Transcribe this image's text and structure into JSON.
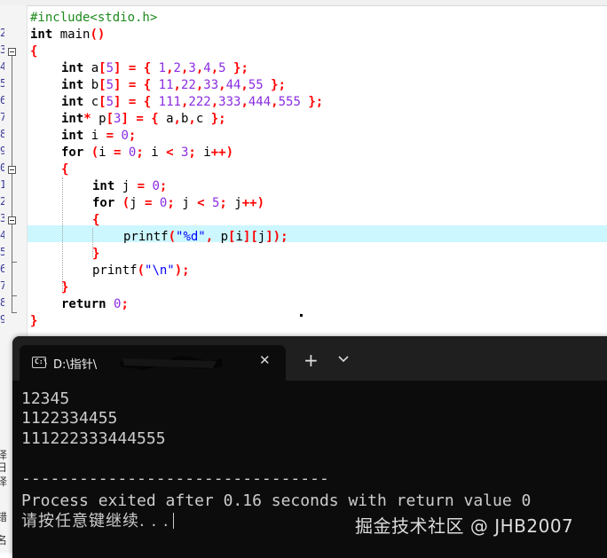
{
  "editor": {
    "line_numbers": [
      "2",
      "3",
      "4",
      "5",
      "6",
      "7",
      "8",
      "9",
      "0",
      "1",
      "2",
      "3",
      "4",
      "5",
      "6",
      "7",
      "8",
      "9",
      "0"
    ],
    "code_lines": [
      "#include<stdio.h>",
      "int main()",
      "{",
      "int a[5] = { 1,2,3,4,5 };",
      "int b[5] = { 11,22,33,44,55 };",
      "int c[5] = { 111,222,333,444,555 };",
      "int* p[3] = { a,b,c };",
      "int i = 0;",
      "for (i = 0; i < 3; i++)",
      "{",
      "int j = 0;",
      "for (j = 0; j < 5; j++)",
      "{",
      "printf(\"%d\", p[i][j]);",
      "}",
      "printf(\"\\n\");",
      "}",
      "return 0;",
      "}"
    ],
    "highlighted_line": 14
  },
  "left_panel": {
    "fragments": [
      "译日",
      "译",
      "错",
      "名"
    ]
  },
  "terminal": {
    "tab_title": "D:\\指针\\",
    "tab_icon": "console-icon",
    "close_icon": "close-icon",
    "new_tab_label": "+",
    "dropdown_icon": "chevron-down-icon",
    "output": [
      "12345",
      "1122334455",
      "111222333444555",
      "",
      "--------------------------------",
      "Process exited after 0.16 seconds with return value 0",
      "请按任意键继续. . ."
    ],
    "watermark": "掘金技术社区 @ JHB2007"
  },
  "colors": {
    "terminal_bg": "#0c0c0c",
    "tabbar_bg": "#1f1f1f",
    "highlight_line": "#ccf7ff",
    "preprocessor": "#1e8a1e",
    "number": "#8a2be2",
    "string": "#0000ff",
    "symbol": "#ff0000"
  }
}
